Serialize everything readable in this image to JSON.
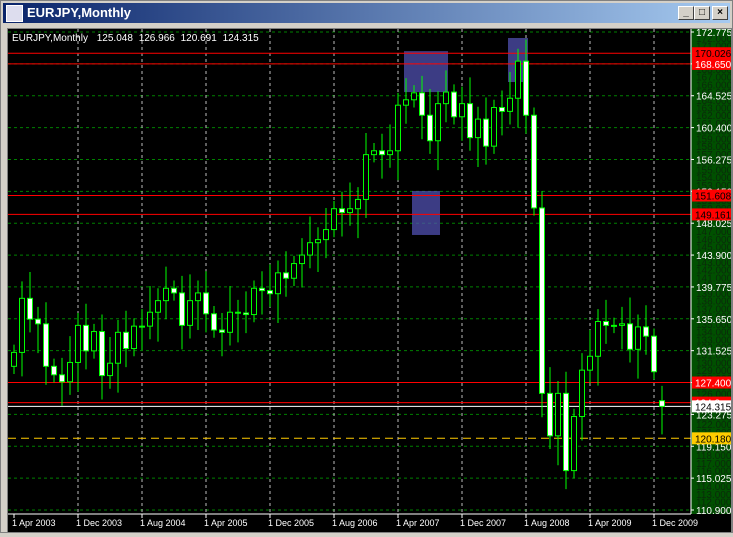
{
  "window": {
    "title": "EURJPY,Monthly",
    "minimize": "_",
    "maximize": "□",
    "close": "×"
  },
  "header": {
    "symbol": "EURJPY,Monthly",
    "open": "125.048",
    "high": "126.966",
    "low": "120.691",
    "close": "124.315"
  },
  "price_axis": {
    "max": 172.775,
    "min": 110.9,
    "major": [
      "172.775",
      "168.650",
      "164.525",
      "160.400",
      "156.275",
      "152.150",
      "148.025",
      "143.900",
      "139.775",
      "135.650",
      "131.525",
      "127.400",
      "123.275",
      "119.150",
      "115.025",
      "110.900"
    ],
    "minor_from": 111,
    "minor_to": 172
  },
  "time_axis": [
    "1 Apr 2003",
    "1 Dec 2003",
    "1 Aug 2004",
    "1 Apr 2005",
    "1 Dec 2005",
    "1 Aug 2006",
    "1 Apr 2007",
    "1 Dec 2007",
    "1 Aug 2008",
    "1 Apr 2009",
    "1 Dec 2009"
  ],
  "levels": [
    {
      "price": 170.026,
      "label": "170.026",
      "color": "#ff0000",
      "text": "#000000"
    },
    {
      "price": 168.65,
      "label": "168.650",
      "color": "#ff0000",
      "text": "#ffffff"
    },
    {
      "price": 151.608,
      "label": "151.608",
      "color": "#ff0000",
      "text": "#000000"
    },
    {
      "price": 149.161,
      "label": "149.161",
      "color": "#ff0000",
      "text": "#000000"
    },
    {
      "price": 127.4,
      "label": "127.400",
      "color": "#ff0000",
      "text": "#ffffff"
    },
    {
      "price": 124.8,
      "label": "124.8",
      "color": "#ff0000",
      "text": "#ffffff"
    },
    {
      "price": 124.315,
      "label": "124.315",
      "color": "#ffffff",
      "text": "#000000"
    },
    {
      "price": 120.18,
      "label": "120.180",
      "color": "#ffcc00",
      "text": "#000000",
      "dashed": true
    }
  ],
  "zones": [
    {
      "from": 49,
      "to": 54,
      "top": 170.3,
      "bottom": 165.0
    },
    {
      "from": 50,
      "to": 53,
      "top": 152.2,
      "bottom": 146.5
    },
    {
      "from": 62,
      "to": 64,
      "top": 172.0,
      "bottom": 166.3
    }
  ],
  "colors": {
    "bull": "#00ff00",
    "bear_body": "#ffffff",
    "grid": "#008000",
    "zone": "#5050b0"
  },
  "closes": [
    131.3,
    138.3,
    135.6,
    135.0,
    129.5,
    128.4,
    127.5,
    130.0,
    134.8,
    131.5,
    134.0,
    128.3,
    129.9,
    133.9,
    131.8,
    134.7,
    134.7,
    136.5,
    138.0,
    139.6,
    139.0,
    134.8,
    138.0,
    139.0,
    136.3,
    134.2,
    133.9,
    136.5,
    136.4,
    136.2,
    139.6,
    139.3,
    138.9,
    141.6,
    140.9,
    142.8,
    143.9,
    145.5,
    145.9,
    147.2,
    149.9,
    149.4,
    149.9,
    151.1,
    156.9,
    157.4,
    156.9,
    157.4,
    163.3,
    164.0,
    164.9,
    162.0,
    158.7,
    163.5,
    165.0,
    161.8,
    163.5,
    159.1,
    161.5,
    158.0,
    163.0,
    162.5,
    164.2,
    169.0,
    162.0,
    150.0,
    126.0,
    120.5,
    126.0,
    116.0,
    123.0,
    129.0,
    130.8,
    135.3,
    134.8,
    134.8,
    135.0,
    131.7,
    134.6,
    133.4,
    128.8,
    124.315
  ],
  "first_open": 129.5
}
